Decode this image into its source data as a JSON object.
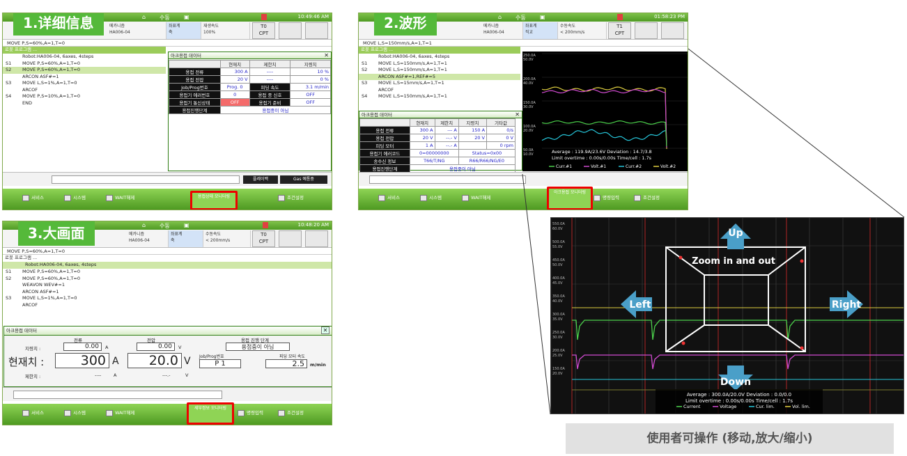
{
  "labels": {
    "p1": "1.详细信息",
    "p2": "2.波形",
    "p3": "3.大画面"
  },
  "caption": "使用者可操作 (移动,放大/缩小)",
  "zoom": {
    "up": "Up",
    "down": "Down",
    "left": "Left",
    "right": "Right",
    "center": "Zoom in and out"
  },
  "common": {
    "time1": "10:49:46 AM",
    "time2": "01:58:23 PM",
    "time3": "10:48:20 AM",
    "mode": "수동",
    "robot": "HA006-04",
    "t0": "T0",
    "t1": "T1",
    "cpt": "CPT",
    "speed": "100%",
    "speed_label": "재생속도",
    "speed2": "< 200mm/s",
    "speed2_label": "수동속도",
    "stat_a": "메카니즘",
    "stat_b": "좌표계",
    "stat_b_val": "축",
    "stat_b_val2": "직교",
    "prog_head": "로봇 프로그램 ...",
    "prog_head3": "Robot:HA006-04, 6axes, 4steps",
    "btn_service": "서비스",
    "btn_system": "시스템",
    "btn_wait": "WAIT해제",
    "btn_cond": "조건설정",
    "btn_cmd": "명령입력",
    "btn_monitor": "용접상태 모니터링",
    "btn_monitor3": "세부정보 모니터링",
    "btn_monitor2": "아크용접 모니터링"
  },
  "p1": {
    "move": "MOVE P,S=60%,A=1,T=0",
    "lines": [
      {
        "s": "",
        "t": "Robot:HA006-04, 6axes, 4steps"
      },
      {
        "s": "S1",
        "t": "MOVE P,S=60%,A=1,T=0"
      },
      {
        "s": "S2",
        "t": "MOVE P,S=60%,A=1,T=0"
      },
      {
        "s": "",
        "t": "ARCON ASF#=1"
      },
      {
        "s": "S3",
        "t": "MOVE L,S=1%,A=1,T=0"
      },
      {
        "s": "",
        "t": "ARCOF"
      },
      {
        "s": "S4",
        "t": "MOVE P,S=10%,A=1,T=0"
      },
      {
        "s": "",
        "t": "END"
      }
    ],
    "dlg_title": "아크용접 데이터",
    "cols": [
      "현재치",
      "제한치",
      "지령치"
    ],
    "rows": [
      {
        "k": "용접 전류",
        "a": "300 A",
        "b": "----",
        "c": "10 %"
      },
      {
        "k": "용접 전압",
        "a": "20 V",
        "b": "----",
        "c": "0 %"
      }
    ],
    "job_k": "Job/Prog번호",
    "job_v": "Prog. 0",
    "feed_k": "피딩 속도",
    "feed_v": "3.1 m/min",
    "err_k": "용접기 에러번호",
    "err_v": "0",
    "end_k": "용접 종 신호",
    "end_v": "OFF",
    "comm_k": "용접기 통신상태",
    "comm_v": "OFF",
    "ready_k": "용접기 준비",
    "ready_v": "OFF",
    "step_k": "용접진행단계",
    "step_v": "용접중이 아님",
    "status1": "플레이백",
    "status2": "Gas 예통중"
  },
  "p2": {
    "move": "MOVE L,S=150mm/s,A=1,T=1",
    "lines": [
      {
        "s": "",
        "t": "Robot:HA006-04, 6axes, 4steps"
      },
      {
        "s": "S1",
        "t": "MOVE L,S=150mm/s,A=1,T=1"
      },
      {
        "s": "S2",
        "t": "MOVE L,S=150mm/s,A=1,T=1"
      },
      {
        "s": "",
        "t": "ARCON ASF#=1,REF#=5"
      },
      {
        "s": "S3",
        "t": "MOVE L,S=15mm/s,A=1,T=1"
      },
      {
        "s": "",
        "t": "ARCOF"
      },
      {
        "s": "S4",
        "t": "MOVE L,S=150mm/s,A=1,T=1"
      }
    ],
    "dlg_title": "아크용접 데이터",
    "cols": [
      "현재치",
      "제한치",
      "지령치",
      "기타값"
    ],
    "rows": [
      {
        "k": "용접 전류",
        "a": "300 A",
        "b": "--- A",
        "c": "150 A",
        "d": "0/s"
      },
      {
        "k": "용접 전압",
        "a": "20 V",
        "b": "--.- V",
        "c": "20 V",
        "d": "0 V"
      },
      {
        "k": "피딩 모터",
        "a": "1 A",
        "b": "--.- A",
        "c": "",
        "d": "0 rpm"
      },
      {
        "k": "용접기 에러코드",
        "a": "0=00000000",
        "b": "",
        "c": "Status=0x00",
        "d": ""
      },
      {
        "k": "송수신 정보",
        "a": "T66/T/NG",
        "b": "",
        "c": "R66/R66/NG/E0",
        "d": ""
      },
      {
        "k": "용접진행단계",
        "a": "용접중이 아님",
        "b": "",
        "c": "",
        "d": ""
      }
    ],
    "wave_stats": "Average : 119.9A/23.6V  Deviation : 14.7/3.8",
    "wave_stats2": "Limit overtime : 0.00s/0.00s  Time/cell : 1.7s",
    "legend": [
      "Curr.#1",
      "Volt.#1",
      "Curr.#2",
      "Volt.#2"
    ],
    "yticks": [
      "250.0A",
      "200.0A",
      "150.0A",
      "100.0A",
      "50.0A"
    ],
    "yticks_v": [
      "50.0V",
      "40.0V",
      "30.0V",
      "20.0V",
      "10.0V"
    ]
  },
  "p3": {
    "move": "MOVE P,S=60%,A=1,T=0",
    "lines": [
      {
        "s": "S1",
        "t": "MOVE P,S=60%,A=1,T=0"
      },
      {
        "s": "S2",
        "t": "MOVE P,S=60%,A=1,T=0"
      },
      {
        "s": "",
        "t": "WEAVON WEV#=1"
      },
      {
        "s": "",
        "t": "ARCON ASF#=1"
      },
      {
        "s": "S3",
        "t": "MOVE L,S=1%,A=1,T=0"
      },
      {
        "s": "",
        "t": "ARCOF"
      }
    ],
    "dlg_title": "아크용접 데이터",
    "cur_label": "전류",
    "volt_label": "전압",
    "step_label": "용접 진행 단계",
    "cmd_k": "지령치 :",
    "cmd_a": "0.00",
    "cmd_a_u": "A",
    "cmd_v": "0.00",
    "cmd_v_u": "V",
    "step_v": "용접중이 아님",
    "now_k": "현재치 :",
    "now_a": "300",
    "now_a_u": "A",
    "now_v": "20.0",
    "now_v_u": "V",
    "job_k": "Job/Prog번호",
    "job_v": "P 1",
    "feed_k": "피딩 모터 속도",
    "feed_v": "2.5",
    "feed_u": "m/min",
    "lim_k": "제한치 :",
    "lim_a": "----",
    "lim_a_u": "A",
    "lim_v": "---.-",
    "lim_v_u": "V"
  },
  "big": {
    "stats": "Average : 300.0A/20.0V  Deviation : 0.0/0.0",
    "stats2": "Limit overtime : 0.00s/0.00s  Time/cell : 1.7s",
    "legend": [
      "Current",
      "Voltage",
      "Cur. lim.",
      "Vol. lim."
    ],
    "yticks": [
      "550.0A",
      "500.0A",
      "450.0A",
      "400.0A",
      "350.0A",
      "300.0A",
      "250.0A",
      "200.0A",
      "150.0A"
    ],
    "yticks_v": [
      "60.0V",
      "55.0V",
      "50.0V",
      "45.0V",
      "40.0V",
      "35.0V",
      "30.0V",
      "25.0V",
      "20.0V",
      "15.0V"
    ]
  },
  "colors": {
    "green": "#55b93a",
    "curr": "#4cd24c",
    "volt": "#d14bd1",
    "curr2": "#26c6da",
    "volt2": "#e0d040",
    "red": "#ee0000"
  }
}
